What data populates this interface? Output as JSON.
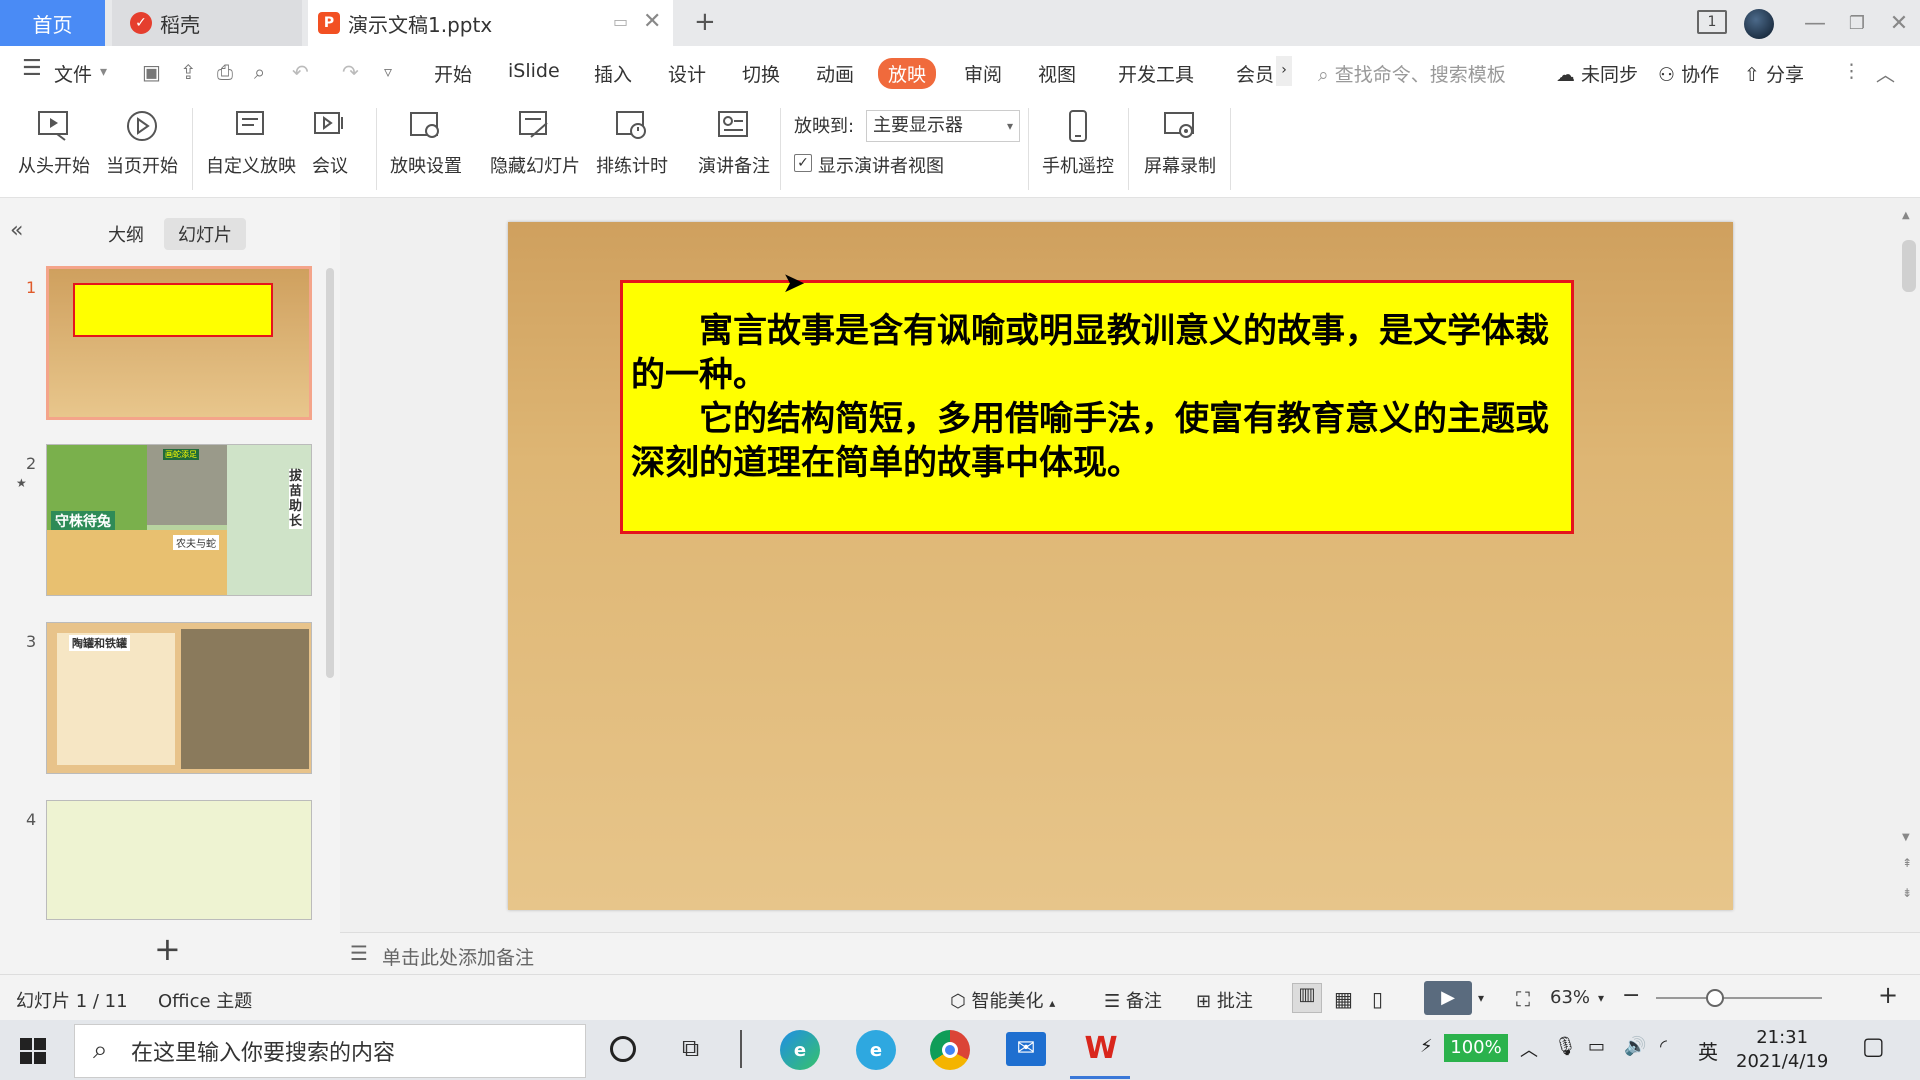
{
  "titlebar": {
    "home_tab": "首页",
    "daoke_tab": "稻壳",
    "doc_tab": "演示文稿1.pptx",
    "new_tab": "+",
    "page_indicator": "1"
  },
  "menu": {
    "file": "文件",
    "tabs": [
      "开始",
      "iSlide",
      "插入",
      "设计",
      "切换",
      "动画",
      "放映",
      "审阅",
      "视图",
      "开发工具",
      "会员"
    ],
    "active_tab": "放映",
    "search_placeholder": "查找命令、搜索模板",
    "unsynced": "未同步",
    "collaborate": "协作",
    "share": "分享"
  },
  "ribbon": {
    "from_start": "从头开始",
    "from_current": "当页开始",
    "custom_show": "自定义放映",
    "meeting": "会议",
    "show_settings": "放映设置",
    "hide_slide": "隐藏幻灯片",
    "rehearse": "排练计时",
    "speaker_notes": "演讲备注",
    "show_to_label": "放映到:",
    "show_to_value": "主要显示器",
    "presenter_view_label": "显示演讲者视图",
    "presenter_view_checked": true,
    "phone_remote": "手机遥控",
    "screen_record": "屏幕录制"
  },
  "left_pane": {
    "tab_outline": "大纲",
    "tab_slides": "幻灯片",
    "thumbnails": [
      {
        "num": "1",
        "selected": true
      },
      {
        "num": "2",
        "selected": false,
        "label_a": "守株待兔",
        "label_b": "农夫与蛇",
        "label_c": "拔苗助长",
        "label_d": "画蛇添足"
      },
      {
        "num": "3",
        "selected": false,
        "title": "陶罐和铁罐"
      },
      {
        "num": "4",
        "selected": false
      }
    ],
    "add_slide": "+"
  },
  "slide": {
    "paragraph1": "寓言故事是含有讽喻或明显教训意义的故事，是文学体裁的一种。",
    "paragraph2": "它的结构简短，多用借喻手法，使富有教育意义的主题或深刻的道理在简单的故事中体现。"
  },
  "notes": {
    "placeholder": "单击此处添加备注"
  },
  "statusbar": {
    "slide_count": "幻灯片 1 / 11",
    "theme": "Office 主题",
    "beautify": "智能美化",
    "notes_btn": "备注",
    "comments_btn": "批注",
    "zoom": "63%"
  },
  "taskbar": {
    "search_placeholder": "在这里输入你要搜索的内容",
    "battery": "100%",
    "ime": "英",
    "time": "21:31",
    "date": "2021/4/19"
  },
  "colors": {
    "accent": "#f06a3c",
    "home_tab": "#4a8bf5",
    "textbox_bg": "#ffff00",
    "textbox_border": "#e5141c"
  }
}
